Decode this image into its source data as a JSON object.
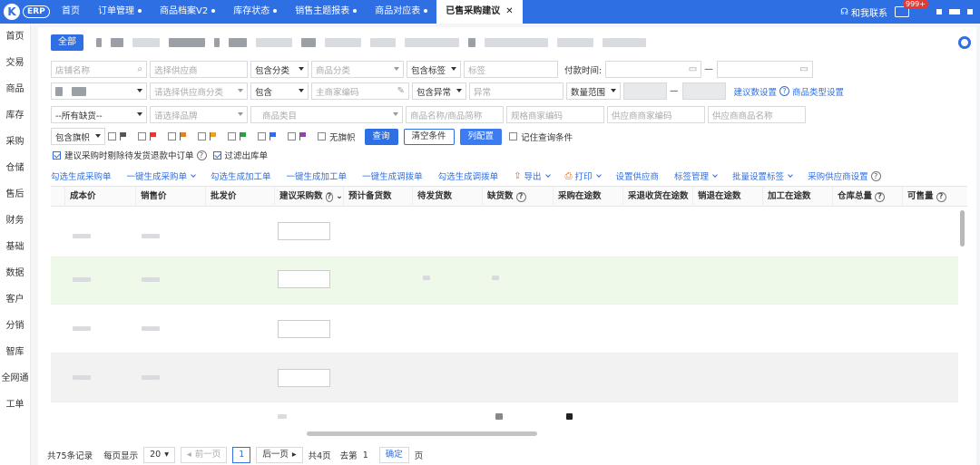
{
  "app": {
    "logo_letter": "K",
    "logo_text": "ERP"
  },
  "nav_tabs": [
    {
      "label": "首页"
    },
    {
      "label": "订单管理"
    },
    {
      "label": "商品档案V2"
    },
    {
      "label": "库存状态"
    },
    {
      "label": "销售主题报表"
    },
    {
      "label": "商品对应表"
    },
    {
      "label": "已售采购建议",
      "active": true
    }
  ],
  "topright": {
    "contact": "和我联系",
    "badge": "999+"
  },
  "sidebar": [
    "首页",
    "交易",
    "商品",
    "库存",
    "采购",
    "仓储",
    "售后",
    "财务",
    "基础",
    "数据",
    "客户",
    "分销",
    "智库",
    "全网通",
    "工单"
  ],
  "filters": {
    "all_button": "全部",
    "shop_name": "店铺名称",
    "select_supplier": "选择供应商",
    "include_category": "包含分类",
    "product_category": "商品分类",
    "include_tag": "包含标签",
    "tag": "标签",
    "pay_time_label": "付款时间:",
    "dash": "—",
    "select_supplier_category": "请选择供应商分类",
    "include": "包含",
    "main_merchant_code": "主商家编码",
    "include_abnormal": "包含异常",
    "abnormal": "异常",
    "qty_range": "数量范围",
    "suggest_setting": "建议数设置",
    "product_type_setting": "商品类型设置",
    "all_shortage": "--所有缺货--",
    "select_brand": "请选择品牌",
    "product_category2": "商品类目",
    "product_name_short": "商品名称/商品简称",
    "spec_merchant_code": "规格商家编码",
    "supplier_merchant_code": "供应商商家编码",
    "supplier_product_name": "供应商商品名称",
    "include_flag": "包含旗帜",
    "no_flag": "无旗帜",
    "query": "查询",
    "clear": "清空条件",
    "columns_config": "列配置",
    "remember": "记住查询条件",
    "exclude_refund": "建议采购时剔除待发货退款中订单",
    "filter_outbound": "过滤出库单"
  },
  "flags": [
    "#555555",
    "#e53935",
    "#e67e22",
    "#f0a020",
    "#2e9e44",
    "#2f6fe4",
    "#8e44ad"
  ],
  "actions": [
    {
      "label": "勾选生成采购单"
    },
    {
      "label": "一键生成采购单",
      "dropdown": true
    },
    {
      "label": "勾选生成加工单"
    },
    {
      "label": "一键生成加工单"
    },
    {
      "label": "一键生成调拨单"
    },
    {
      "label": "勾选生成调拨单"
    },
    {
      "label": "导出",
      "dropdown": true,
      "icon": "export-icon"
    },
    {
      "label": "打印",
      "dropdown": true,
      "icon": "print-icon"
    },
    {
      "label": "设置供应商"
    },
    {
      "label": "标签管理",
      "dropdown": true
    },
    {
      "label": "批量设置标签",
      "dropdown": true
    },
    {
      "label": "采购供应商设置"
    }
  ],
  "columns": [
    "成本价",
    "销售价",
    "批发价",
    "建议采购数",
    "预计备货数",
    "待发货数",
    "缺货数",
    "采购在途数",
    "采退收货在途数",
    "销退在途数",
    "加工在途数",
    "仓库总量",
    "可售量"
  ],
  "pager": {
    "total": "共75条记录",
    "per_page_label": "每页显示",
    "per_page": "20",
    "prev": "前一页",
    "current": "1",
    "next": "后一页",
    "pages": "共4页",
    "goto": "去第",
    "goto_value": "1",
    "confirm": "确定",
    "page_unit": "页"
  }
}
